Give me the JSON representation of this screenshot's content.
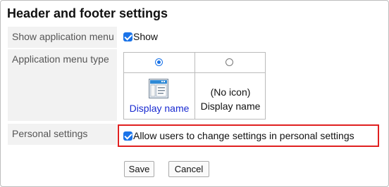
{
  "section": {
    "title": "Header and footer settings"
  },
  "rows": {
    "show_menu": {
      "label": "Show application menu",
      "checkbox_label": "Show",
      "checked": true
    },
    "menu_type": {
      "label": "Application menu type",
      "options": [
        {
          "selected": true,
          "icon": "app-window-icon",
          "text": "Display name"
        },
        {
          "selected": false,
          "icon": "none",
          "line1": "(No icon)",
          "line2": "Display name"
        }
      ]
    },
    "personal": {
      "label": "Personal settings",
      "checkbox_label": "Allow users to change settings in personal settings",
      "checked": true
    }
  },
  "buttons": {
    "save": "Save",
    "cancel": "Cancel"
  },
  "colors": {
    "accent": "#1a73e8",
    "link": "#1a2bd1",
    "highlight": "#e02020",
    "label_bg": "#f2f2f2"
  }
}
